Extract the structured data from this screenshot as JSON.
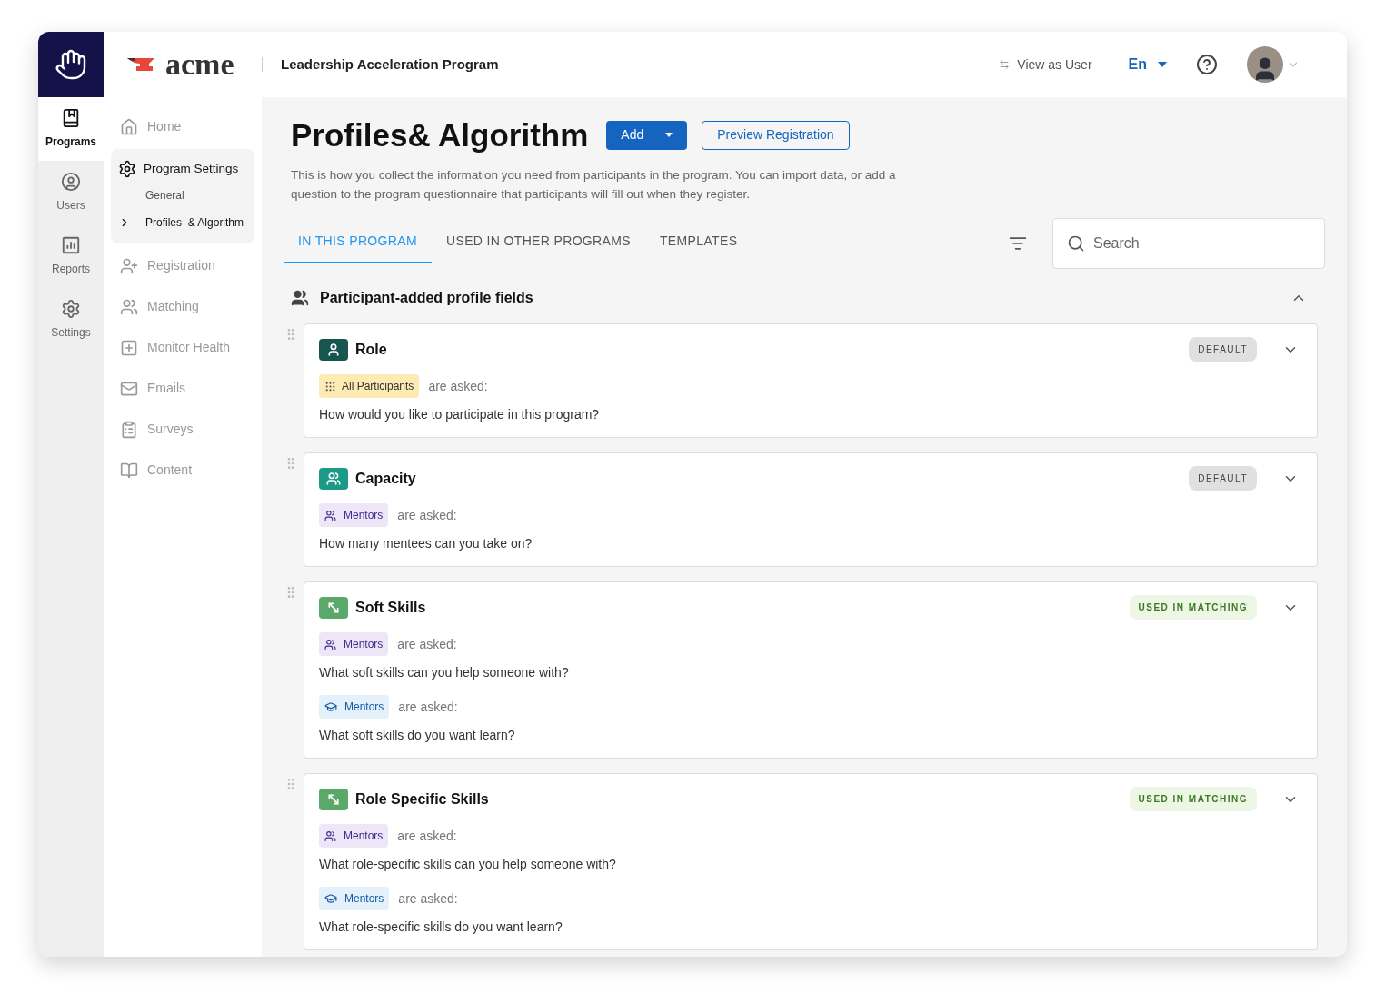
{
  "header": {
    "logo": "acme",
    "program_title": "Leadership Acceleration Program",
    "view_as_user": "View as User",
    "language": "En"
  },
  "rail": [
    {
      "label": "Programs",
      "selected": true
    },
    {
      "label": "Users",
      "selected": false
    },
    {
      "label": "Reports",
      "selected": false
    },
    {
      "label": "Settings",
      "selected": false
    }
  ],
  "nav": [
    {
      "label": "Home"
    },
    {
      "label": "Program Settings",
      "children": [
        {
          "label": "General",
          "selected": false
        },
        {
          "label": "Profiles  & Algorithm",
          "selected": true
        }
      ]
    },
    {
      "label": "Registration"
    },
    {
      "label": "Matching"
    },
    {
      "label": "Monitor Health"
    },
    {
      "label": "Emails"
    },
    {
      "label": "Surveys"
    },
    {
      "label": "Content"
    }
  ],
  "page": {
    "title": "Profiles& Algorithm",
    "add_button": "Add",
    "preview_button": "Preview Registration",
    "description": "This is how you collect the information you need from participants in the program. You can import data, or add a question to the program questionnaire that participants will fill out when they register."
  },
  "tabs": [
    {
      "label": "IN THIS PROGRAM",
      "selected": true
    },
    {
      "label": "USED IN OTHER PROGRAMS",
      "selected": false
    },
    {
      "label": "TEMPLATES",
      "selected": false
    }
  ],
  "search": {
    "placeholder": "Search"
  },
  "section": {
    "title": "Participant-added profile fields",
    "expanded": true
  },
  "fields": [
    {
      "name": "Role",
      "badge": {
        "kind": "default",
        "label": "DEFAULT"
      },
      "questions": [
        {
          "audience": {
            "kind": "all",
            "label": "All Participants"
          },
          "asked": "are asked:",
          "question": "How would you like to participate in this program?"
        }
      ]
    },
    {
      "name": "Capacity",
      "badge": {
        "kind": "default",
        "label": "DEFAULT"
      },
      "questions": [
        {
          "audience": {
            "kind": "mentor",
            "label": "Mentors"
          },
          "asked": "are asked:",
          "question": "How many mentees can you take on?"
        }
      ]
    },
    {
      "name": "Soft Skills",
      "badge": {
        "kind": "matching",
        "label": "USED IN MATCHING"
      },
      "questions": [
        {
          "audience": {
            "kind": "mentor",
            "label": "Mentors"
          },
          "asked": "are asked:",
          "question": "What soft skills can you help someone with?"
        },
        {
          "audience": {
            "kind": "mentee",
            "label": "Mentors"
          },
          "asked": "are asked:",
          "question": "What soft skills do you want learn?"
        }
      ]
    },
    {
      "name": "Role Specific Skills",
      "badge": {
        "kind": "matching",
        "label": "USED IN MATCHING"
      },
      "questions": [
        {
          "audience": {
            "kind": "mentor",
            "label": "Mentors"
          },
          "asked": "are asked:",
          "question": "What role-specific skills can you help someone with?"
        },
        {
          "audience": {
            "kind": "mentee",
            "label": "Mentors"
          },
          "asked": "are asked:",
          "question": "What role-specific skills do you want learn?"
        }
      ]
    }
  ]
}
